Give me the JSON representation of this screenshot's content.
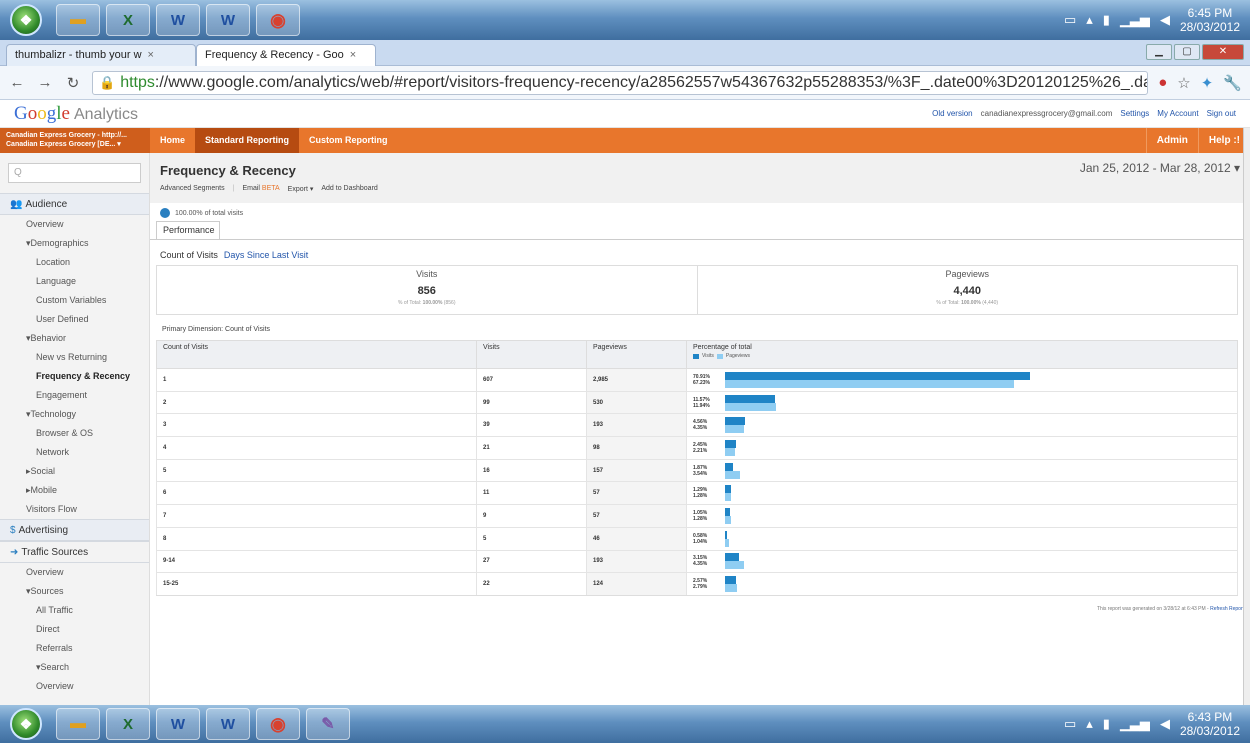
{
  "taskbar_top": {
    "time": "6:45 PM",
    "date": "28/03/2012"
  },
  "taskbar_bottom": {
    "time": "6:43 PM",
    "date": "28/03/2012"
  },
  "browser": {
    "tabs": [
      {
        "label": "thumbalizr - thumb your w",
        "active": false
      },
      {
        "label": "Frequency & Recency - Goo",
        "active": true
      }
    ],
    "url_scheme": "https",
    "url_rest": "://www.google.com/analytics/web/#report/visitors-frequency-recency/a28562557w54367632p55288353/%3F_.date00%3D20120125%26_.date01%3D20120328/"
  },
  "ga": {
    "logo_google": [
      "G",
      "o",
      "o",
      "g",
      "l",
      "e"
    ],
    "logo_analytics": "Analytics",
    "header_links": {
      "email": "canadianexpressgrocery@gmail.com",
      "old_version": "Old version",
      "settings": "Settings",
      "my_account": "My Account",
      "sign_out": "Sign out"
    },
    "account": {
      "line1": "Canadian Express Grocery - http://...",
      "line2": "Canadian Express Grocery [DE... ▾"
    },
    "nav": {
      "home": "Home",
      "standard": "Standard Reporting",
      "custom": "Custom Reporting",
      "admin": "Admin",
      "help": "Help :!"
    }
  },
  "sidebar": {
    "search_placeholder": "Q",
    "audience": "Audience",
    "items_audience": [
      {
        "label": "Overview",
        "level": "l1b"
      },
      {
        "label": "▾Demographics",
        "level": "l1b"
      },
      {
        "label": "Location",
        "level": "l2"
      },
      {
        "label": "Language",
        "level": "l2"
      },
      {
        "label": "Custom Variables",
        "level": "l2"
      },
      {
        "label": "User Defined",
        "level": "l2"
      },
      {
        "label": "▾Behavior",
        "level": "l1b"
      },
      {
        "label": "New vs Returning",
        "level": "l2"
      },
      {
        "label": "Frequency & Recency",
        "level": "l2",
        "active": true
      },
      {
        "label": "Engagement",
        "level": "l2"
      },
      {
        "label": "▾Technology",
        "level": "l1b"
      },
      {
        "label": "Browser & OS",
        "level": "l2"
      },
      {
        "label": "Network",
        "level": "l2"
      },
      {
        "label": "▸Social",
        "level": "l1b"
      },
      {
        "label": "▸Mobile",
        "level": "l1b"
      },
      {
        "label": "Visitors Flow",
        "level": "l1b"
      }
    ],
    "advertising": "Advertising",
    "traffic_sources": "Traffic Sources",
    "items_traffic": [
      {
        "label": "Overview",
        "level": "l1b"
      },
      {
        "label": "▾Sources",
        "level": "l1b"
      },
      {
        "label": "All Traffic",
        "level": "l2"
      },
      {
        "label": "Direct",
        "level": "l2"
      },
      {
        "label": "Referrals",
        "level": "l2"
      },
      {
        "label": "▾Search",
        "level": "l2"
      },
      {
        "label": "Overview",
        "level": "l2"
      }
    ]
  },
  "report": {
    "title": "Frequency & Recency",
    "date_range": "Jan 25, 2012 - Mar 28, 2012",
    "actions": {
      "segments": "Advanced Segments",
      "email": "Email",
      "email_beta": "BETA",
      "export": "Export ▾",
      "dashboard": "Add to Dashboard"
    },
    "segment_label": "100.00% of total visits",
    "performance_tab": "Performance",
    "subtab_active": "Count of Visits",
    "subtab_link": "Days Since Last Visit",
    "visits": {
      "label": "Visits",
      "value": "856",
      "sub_prefix": "% of Total: ",
      "sub_pct": "100.00%",
      "sub_total": " (856)"
    },
    "pageviews": {
      "label": "Pageviews",
      "value": "4,440",
      "sub_prefix": "% of Total: ",
      "sub_pct": "100.00%",
      "sub_total": " (4,440)"
    },
    "primary_dimension": "Primary Dimension:  Count of Visits",
    "columns": {
      "count": "Count of Visits",
      "visits": "Visits",
      "pageviews": "Pageviews",
      "pct": "Percentage of total",
      "legend_visits": "Visits",
      "legend_pageviews": "Pageviews"
    },
    "rows": [
      {
        "count": "1",
        "visits": "607",
        "pageviews": "2,985",
        "visits_pct": "70.91%",
        "pageviews_pct": "67.23%",
        "visits_frac": 0.7091,
        "pageviews_frac": 0.6723
      },
      {
        "count": "2",
        "visits": "99",
        "pageviews": "530",
        "visits_pct": "11.57%",
        "pageviews_pct": "11.94%",
        "visits_frac": 0.1157,
        "pageviews_frac": 0.1194
      },
      {
        "count": "3",
        "visits": "39",
        "pageviews": "193",
        "visits_pct": "4.56%",
        "pageviews_pct": "4.35%",
        "visits_frac": 0.0456,
        "pageviews_frac": 0.0435
      },
      {
        "count": "4",
        "visits": "21",
        "pageviews": "98",
        "visits_pct": "2.45%",
        "pageviews_pct": "2.21%",
        "visits_frac": 0.0245,
        "pageviews_frac": 0.0221
      },
      {
        "count": "5",
        "visits": "16",
        "pageviews": "157",
        "visits_pct": "1.87%",
        "pageviews_pct": "3.54%",
        "visits_frac": 0.0187,
        "pageviews_frac": 0.0354
      },
      {
        "count": "6",
        "visits": "11",
        "pageviews": "57",
        "visits_pct": "1.29%",
        "pageviews_pct": "1.28%",
        "visits_frac": 0.0129,
        "pageviews_frac": 0.0128
      },
      {
        "count": "7",
        "visits": "9",
        "pageviews": "57",
        "visits_pct": "1.05%",
        "pageviews_pct": "1.28%",
        "visits_frac": 0.0105,
        "pageviews_frac": 0.0128
      },
      {
        "count": "8",
        "visits": "5",
        "pageviews": "46",
        "visits_pct": "0.58%",
        "pageviews_pct": "1.04%",
        "visits_frac": 0.0058,
        "pageviews_frac": 0.0104
      },
      {
        "count": "9-14",
        "visits": "27",
        "pageviews": "193",
        "visits_pct": "3.15%",
        "pageviews_pct": "4.35%",
        "visits_frac": 0.0315,
        "pageviews_frac": 0.0435
      },
      {
        "count": "15-25",
        "visits": "22",
        "pageviews": "124",
        "visits_pct": "2.57%",
        "pageviews_pct": "2.79%",
        "visits_frac": 0.0257,
        "pageviews_frac": 0.0279
      }
    ],
    "footer_note": "This report was generated on 3/28/12 at 6:43 PM - ",
    "footer_link": "Refresh Report"
  },
  "colors": {
    "orange": "#e8762c",
    "visits_bar": "#1f84c6",
    "pageviews_bar": "#8fcdf2"
  }
}
